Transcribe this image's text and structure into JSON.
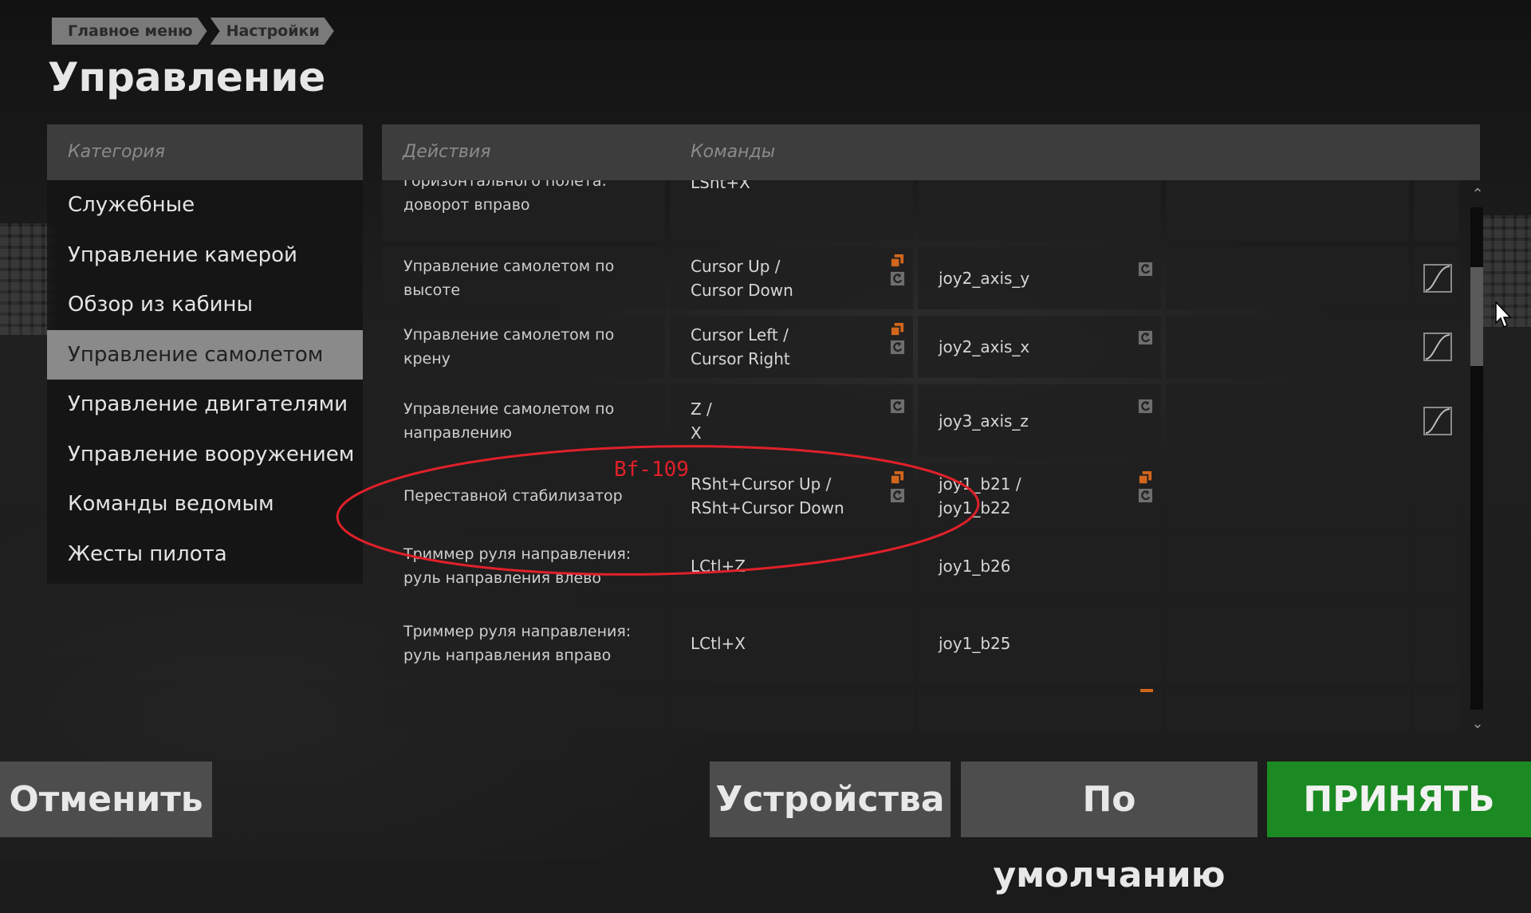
{
  "breadcrumb": [
    "Главное меню",
    "Настройки"
  ],
  "title": "Управление",
  "categories": {
    "header": "Категория",
    "items": [
      "Служебные",
      "Управление камерой",
      "Обзор из кабины",
      "Управление самолетом",
      "Управление двигателями",
      "Управление вооружением",
      "Команды ведомым",
      "Жесты пилота"
    ],
    "active": "Управление самолетом"
  },
  "table": {
    "actions_header": "Действия",
    "commands_header": "Команды",
    "rows": [
      {
        "action": "горизонтального полета: доворот вправо",
        "key": "LSht+X",
        "device": ""
      },
      {
        "action": "Управление самолетом по высоте",
        "key": "Cursor Up /\nCursor Down",
        "device": "joy2_axis_y"
      },
      {
        "action": "Управление самолетом по крену",
        "key": "Cursor Left /\nCursor Right",
        "device": "joy2_axis_x"
      },
      {
        "action": "Управление самолетом по направлению",
        "key": "Z /\nX",
        "device": "joy3_axis_z"
      },
      {
        "action": "Переставной стабилизатор",
        "key": "RSht+Cursor Up /\nRSht+Cursor Down",
        "device": "joy1_b21 /\njoy1_b22"
      },
      {
        "action": "Триммер руля направления: руль направления влево",
        "key": "LCtl+Z",
        "device": "joy1_b26"
      },
      {
        "action": "Триммер руля направления: руль направления вправо",
        "key": "LCtl+X",
        "device": "joy1_b25"
      }
    ]
  },
  "annotation": {
    "label": "Bf-109",
    "color": "#e0202a"
  },
  "buttons": {
    "cancel": "Отменить",
    "devices": "Устройства",
    "defaults": "По умолчанию",
    "accept": "ПРИНЯТЬ"
  },
  "colors": {
    "accent_green": "#1c8a22",
    "icon_orange": "#d2661c",
    "icon_gray": "#7a7a7a"
  },
  "icons": [
    "copy-binding-icon",
    "reset-binding-icon",
    "response-curve-icon",
    "chevron-up-icon",
    "chevron-down-icon",
    "mouse-cursor-icon"
  ]
}
